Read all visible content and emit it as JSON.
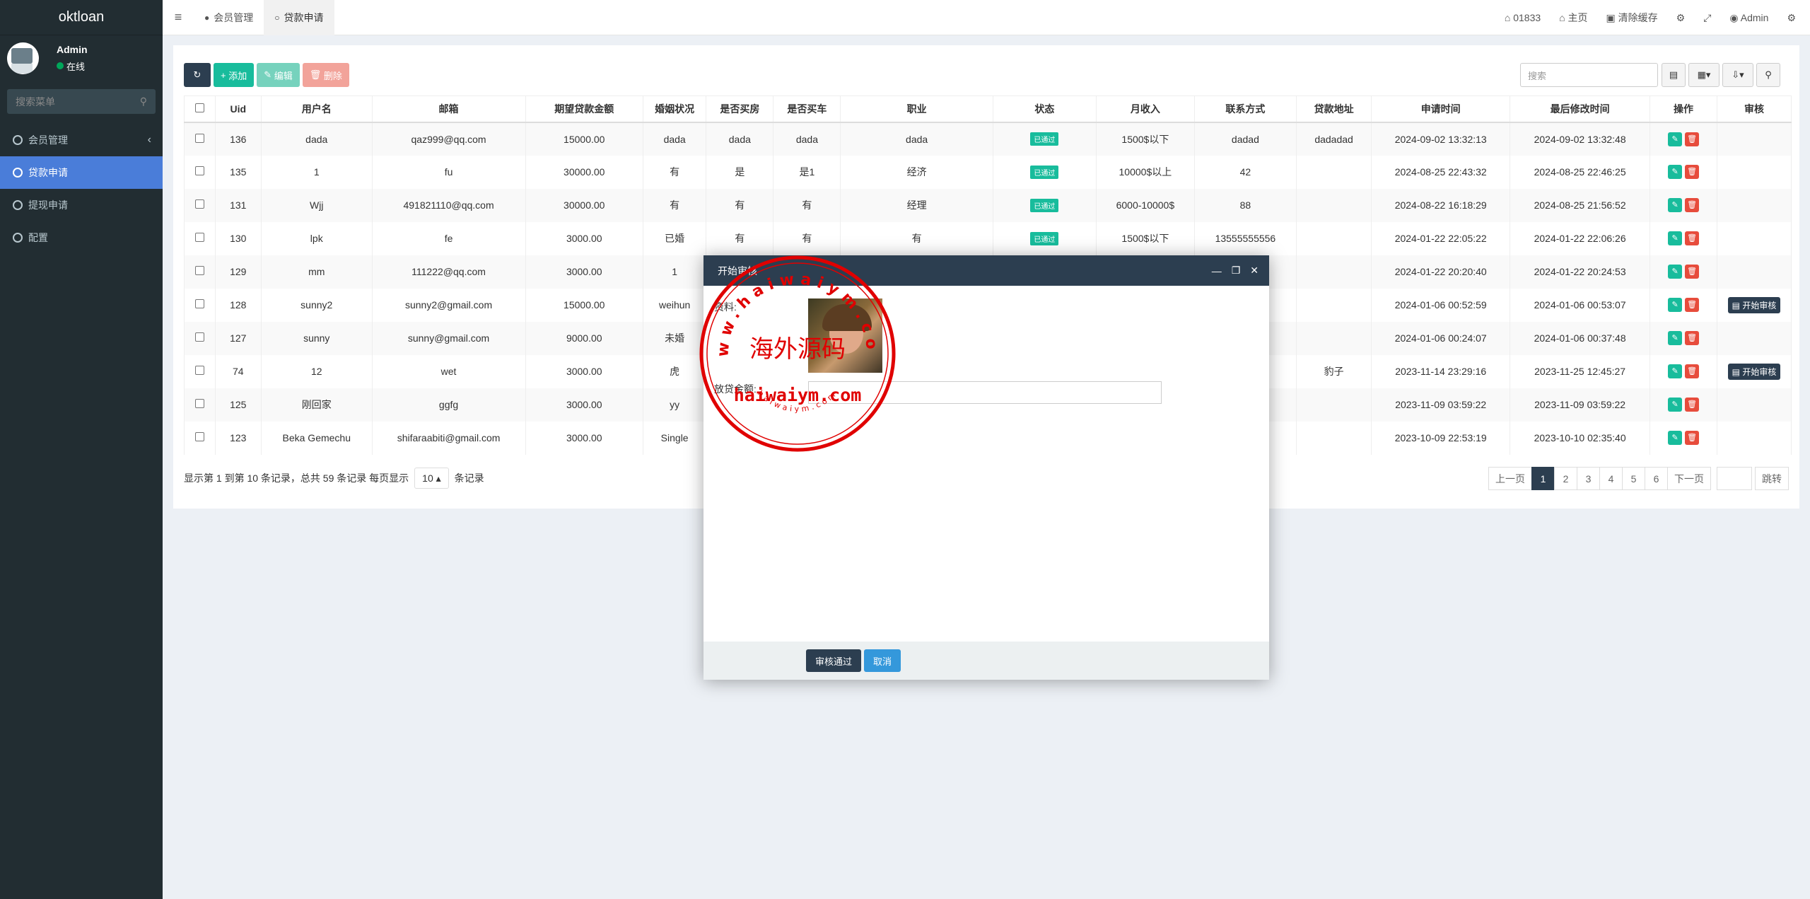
{
  "sidebar": {
    "logo": "oktloan",
    "user_name": "Admin",
    "user_status": "在线",
    "search_placeholder": "搜索菜单",
    "items": [
      {
        "label": "会员管理"
      },
      {
        "label": "贷款申请"
      },
      {
        "label": "提现申请"
      },
      {
        "label": "配置"
      }
    ]
  },
  "topbar": {
    "tabs": [
      {
        "label": "会员管理"
      },
      {
        "label": "贷款申请"
      }
    ],
    "counter": "01833",
    "home": "主页",
    "clear_cache": "清除缓存",
    "admin": "Admin"
  },
  "toolbar": {
    "add": "添加",
    "edit": "编辑",
    "delete": "删除",
    "search_placeholder": "搜索"
  },
  "table": {
    "headers": [
      "Uid",
      "用户名",
      "邮箱",
      "期望贷款金额",
      "婚姻状况",
      "是否买房",
      "是否买车",
      "职业",
      "状态",
      "月收入",
      "联系方式",
      "贷款地址",
      "申请时间",
      "最后修改时间",
      "操作",
      "审核"
    ],
    "rows": [
      {
        "uid": "136",
        "name": "dada",
        "email": "qaz999@qq.com",
        "amount": "15000.00",
        "marital": "dada",
        "house": "dada",
        "car": "dada",
        "job": "dada",
        "status": "已通过",
        "income": "1500$以下",
        "contact": "dadad",
        "address": "dadadad",
        "applied": "2024-09-02 13:32:13",
        "modified": "2024-09-02 13:32:48",
        "audit": ""
      },
      {
        "uid": "135",
        "name": "1",
        "email": "fu",
        "amount": "30000.00",
        "marital": "有",
        "house": "是",
        "car": "是1",
        "job": "经济",
        "status": "已通过",
        "income": "10000$以上",
        "contact": "42",
        "address": "",
        "applied": "2024-08-25 22:43:32",
        "modified": "2024-08-25 22:46:25",
        "audit": ""
      },
      {
        "uid": "131",
        "name": "Wjj",
        "email": "491821110@qq.com",
        "amount": "30000.00",
        "marital": "有",
        "house": "有",
        "car": "有",
        "job": "经理",
        "status": "已通过",
        "income": "6000-10000$",
        "contact": "88",
        "address": "",
        "applied": "2024-08-22 16:18:29",
        "modified": "2024-08-25 21:56:52",
        "audit": ""
      },
      {
        "uid": "130",
        "name": "lpk",
        "email": "fe",
        "amount": "3000.00",
        "marital": "已婚",
        "house": "有",
        "car": "有",
        "job": "有",
        "status": "已通过",
        "income": "1500$以下",
        "contact": "13555555556",
        "address": "",
        "applied": "2024-01-22 22:05:22",
        "modified": "2024-01-22 22:06:26",
        "audit": ""
      },
      {
        "uid": "129",
        "name": "mm",
        "email": "111222@qq.com",
        "amount": "3000.00",
        "marital": "1",
        "house": "",
        "car": "",
        "job": "",
        "status": "",
        "income": "",
        "contact": "",
        "address": "",
        "applied": "2024-01-22 20:20:40",
        "modified": "2024-01-22 20:24:53",
        "audit": ""
      },
      {
        "uid": "128",
        "name": "sunny2",
        "email": "sunny2@gmail.com",
        "amount": "15000.00",
        "marital": "weihun",
        "house": "",
        "car": "",
        "job": "",
        "status": "",
        "income": "",
        "contact": "",
        "address": "",
        "applied": "2024-01-06 00:52:59",
        "modified": "2024-01-06 00:53:07",
        "audit": "开始审核"
      },
      {
        "uid": "127",
        "name": "sunny",
        "email": "sunny@gmail.com",
        "amount": "9000.00",
        "marital": "未婚",
        "house": "",
        "car": "",
        "job": "",
        "status": "",
        "income": "",
        "contact": "",
        "address": "",
        "applied": "2024-01-06 00:24:07",
        "modified": "2024-01-06 00:37:48",
        "audit": ""
      },
      {
        "uid": "74",
        "name": "12",
        "email": "wet",
        "amount": "3000.00",
        "marital": "虎",
        "house": "",
        "car": "",
        "job": "",
        "status": "",
        "income": "",
        "contact": "",
        "address": "豹子",
        "applied": "2023-11-14 23:29:16",
        "modified": "2023-11-25 12:45:27",
        "audit": "开始审核"
      },
      {
        "uid": "125",
        "name": "刚回家",
        "email": "ggfg",
        "amount": "3000.00",
        "marital": "yy",
        "house": "",
        "car": "",
        "job": "",
        "status": "",
        "income": "",
        "contact": "",
        "address": "",
        "applied": "2023-11-09 03:59:22",
        "modified": "2023-11-09 03:59:22",
        "audit": ""
      },
      {
        "uid": "123",
        "name": "Beka Gemechu",
        "email": "shifaraabiti@gmail.com",
        "amount": "3000.00",
        "marital": "Single",
        "house": "",
        "car": "",
        "job": "",
        "status": "",
        "income": "",
        "contact": "",
        "address": "",
        "applied": "2023-10-09 22:53:19",
        "modified": "2023-10-10 02:35:40",
        "audit": ""
      }
    ]
  },
  "footer": {
    "info_prefix": "显示第 1 到第 10 条记录，总共 59 条记录 每页显示",
    "page_size": "10",
    "info_suffix": "条记录",
    "prev": "上一页",
    "pages": [
      "1",
      "2",
      "3",
      "4",
      "5",
      "6"
    ],
    "next": "下一页",
    "jump": "跳转"
  },
  "modal": {
    "title": "开始审核",
    "label_photo": "资料:",
    "label_amount": "放贷金额:",
    "approve": "审核通过",
    "cancel": "取消"
  },
  "stamp": {
    "top_arc": "www.haiwaiym.com",
    "center": "海外源码",
    "main": "haiwaiym.com",
    "bottom_arc": "haiwaiym.com",
    "color": "#e00000"
  }
}
